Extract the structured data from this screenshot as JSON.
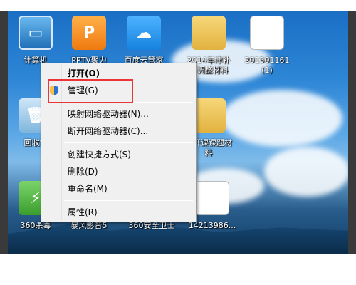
{
  "desktop": {
    "icons": [
      {
        "label": "计算机",
        "name": "computer"
      },
      {
        "label": "PPTV聚力",
        "name": "pptv"
      },
      {
        "label": "百度云管家",
        "name": "baidu-cloud"
      },
      {
        "label": "2014年津补贴调整材料",
        "name": "folder-2014"
      },
      {
        "label": "201501161 (1)",
        "name": "doc-20150116"
      },
      {
        "label": "回收站",
        "name": "recycle-bin"
      },
      {
        "label": "公开课课题材料",
        "name": "folder-course"
      },
      {
        "label": "360杀毒",
        "name": "360-antivirus"
      },
      {
        "label": "暴风影音5",
        "name": "baofeng"
      },
      {
        "label": "360安全卫士",
        "name": "360-safe"
      },
      {
        "label": "14213986...",
        "name": "doc-14213986"
      }
    ]
  },
  "context_menu": {
    "open": "打开(O)",
    "manage": "管理(G)",
    "map_drive": "映射网络驱动器(N)...",
    "disconnect_drive": "断开网络驱动器(C)...",
    "create_shortcut": "创建快捷方式(S)",
    "delete": "删除(D)",
    "rename": "重命名(M)",
    "properties": "属性(R)"
  },
  "icons": {
    "manage": "shield-icon"
  },
  "colors": {
    "highlight_box": "#e8363a"
  }
}
